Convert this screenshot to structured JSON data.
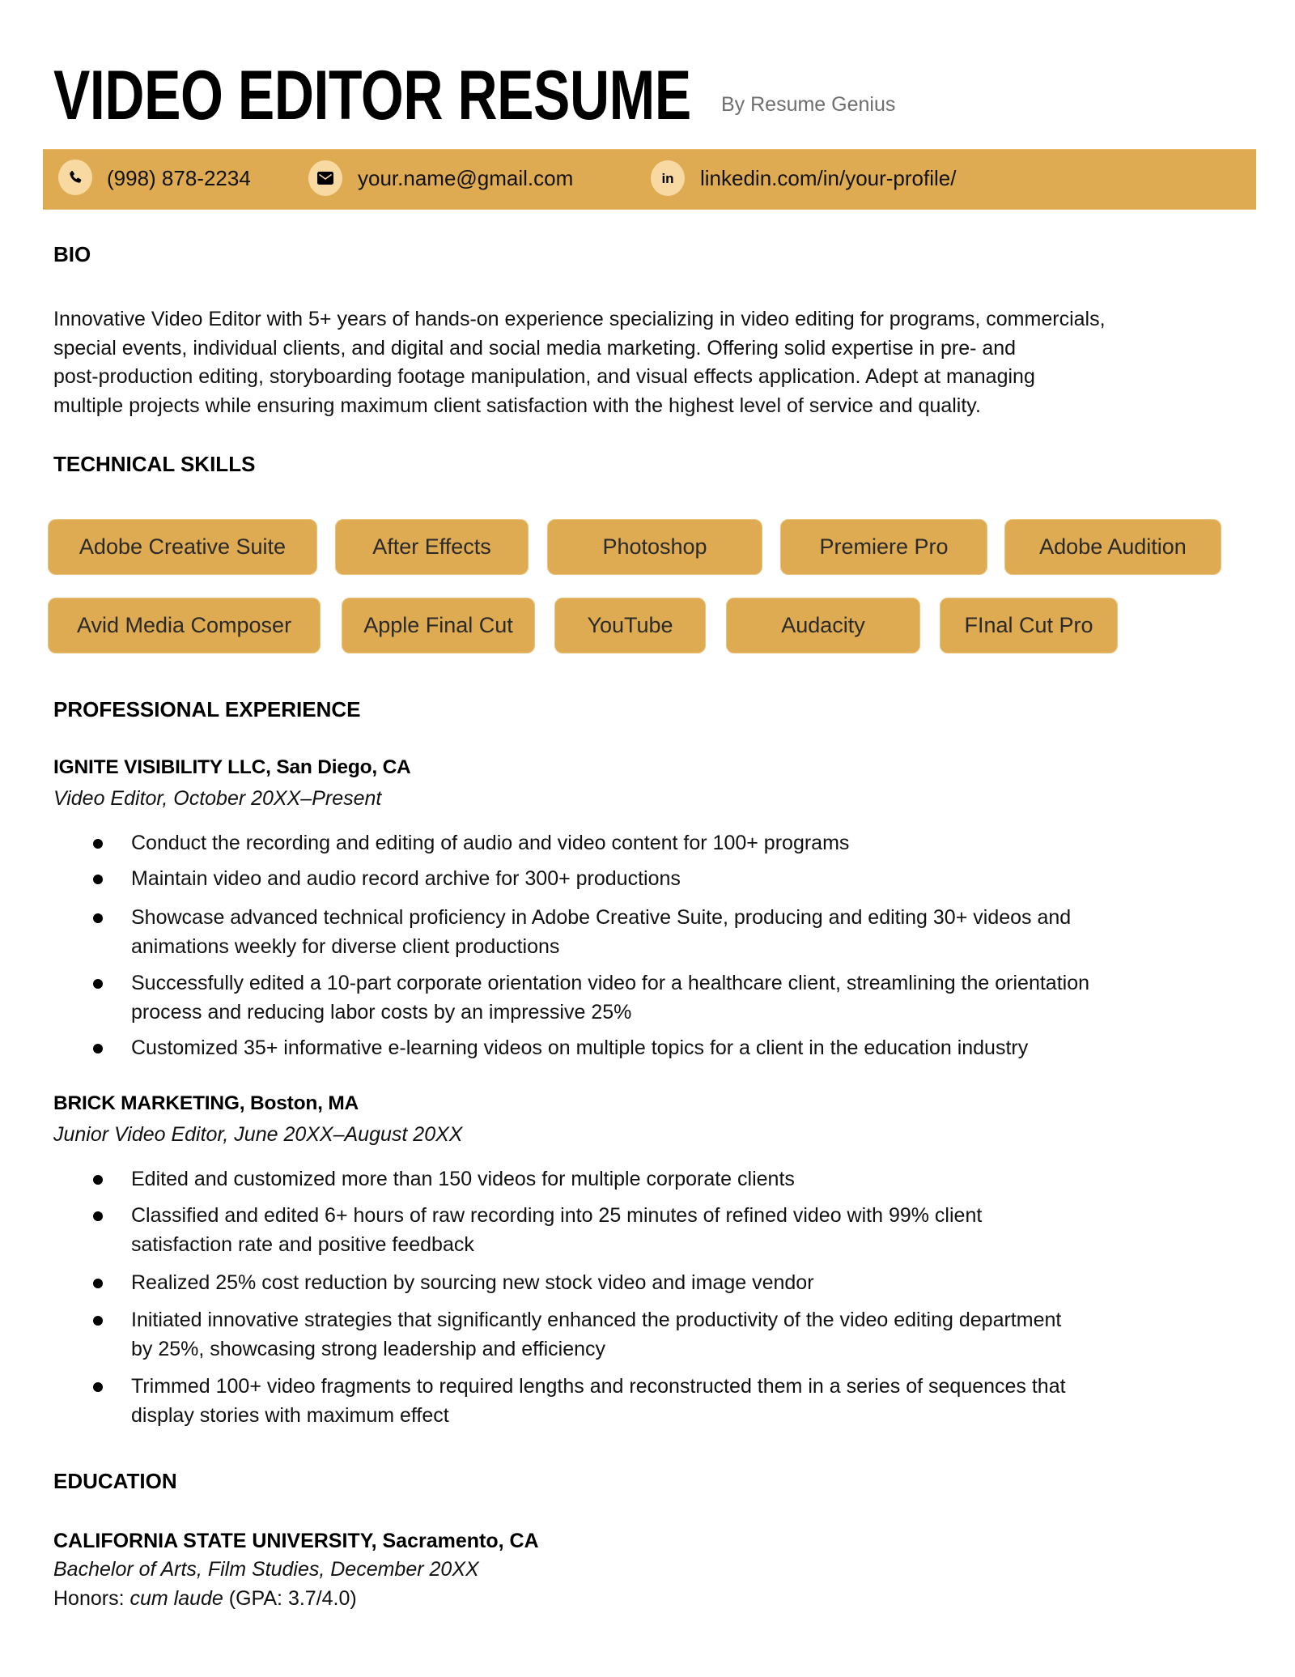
{
  "header": {
    "title": "VIDEO EDITOR RESUME",
    "byline": "By Resume Genius"
  },
  "contact": {
    "phone": {
      "icon": "phone-icon",
      "text": "(998) 878-2234"
    },
    "email": {
      "icon": "mail-icon",
      "text": "your.name@gmail.com"
    },
    "linkedin": {
      "icon": "linkedin-icon",
      "text": "linkedin.com/in/your-profile/"
    }
  },
  "colors": {
    "accent": "#DEAB53",
    "icon_circle": "#F9D9A2",
    "byline_gray": "#6E6E6E"
  },
  "bio": {
    "heading": "BIO",
    "lines": [
      "Innovative Video Editor with 5+ years of hands-on experience specializing in video editing for programs, commercials,",
      "special events, individual clients, and digital and social media marketing. Offering solid expertise in pre- and",
      "post-production editing, storyboarding footage manipulation, and visual effects application. Adept at managing",
      "multiple projects while ensuring maximum client satisfaction with the highest level of service and quality."
    ]
  },
  "skills": {
    "heading": "TECHNICAL SKILLS",
    "items": [
      "Adobe Creative Suite",
      "After Effects",
      "Photoshop",
      "Premiere Pro",
      "Adobe Audition",
      "Avid Media Composer",
      "Apple Final Cut",
      "YouTube",
      "Audacity",
      "FInal Cut Pro"
    ]
  },
  "experience": {
    "heading": "PROFESSIONAL EXPERIENCE",
    "jobs": [
      {
        "company": "IGNITE VISIBILITY LLC, San Diego, CA",
        "role": "Video Editor, October 20XX–Present",
        "bullets": [
          [
            "Conduct the recording and editing of audio and video content for 100+ programs"
          ],
          [
            "Maintain video and audio record archive for 300+ productions"
          ],
          [
            "Showcase advanced technical proficiency in Adobe Creative Suite, producing and editing 30+ videos and",
            "animations weekly for diverse client productions"
          ],
          [
            "Successfully edited a 10-part corporate orientation video for a healthcare client, streamlining the orientation",
            "process and reducing labor costs by an impressive 25%"
          ],
          [
            "Customized 35+ informative e-learning videos on multiple topics for a client in the education industry"
          ]
        ]
      },
      {
        "company": "BRICK MARKETING, Boston, MA",
        "role": "Junior Video Editor, June 20XX–August 20XX",
        "bullets": [
          [
            "Edited and customized more than 150 videos for multiple corporate clients"
          ],
          [
            "Classified and edited 6+ hours of raw recording into 25 minutes of refined video with 99% client",
            "satisfaction rate and positive feedback"
          ],
          [
            "Realized 25% cost reduction by sourcing new stock video and image vendor"
          ],
          [
            "Initiated innovative strategies that significantly enhanced the productivity of the video editing department",
            "by 25%, showcasing strong leadership and efficiency"
          ],
          [
            "Trimmed 100+ video fragments to required lengths and reconstructed them in a series of sequences that",
            "display stories with maximum effect"
          ]
        ]
      }
    ]
  },
  "education": {
    "heading": "EDUCATION",
    "school": "CALIFORNIA STATE UNIVERSITY, Sacramento, CA",
    "degree": "Bachelor of Arts, Film Studies, December 20XX",
    "honors_label": "Honors: ",
    "honors_value": "cum laude",
    "gpa": " (GPA: 3.7/4.0)"
  }
}
